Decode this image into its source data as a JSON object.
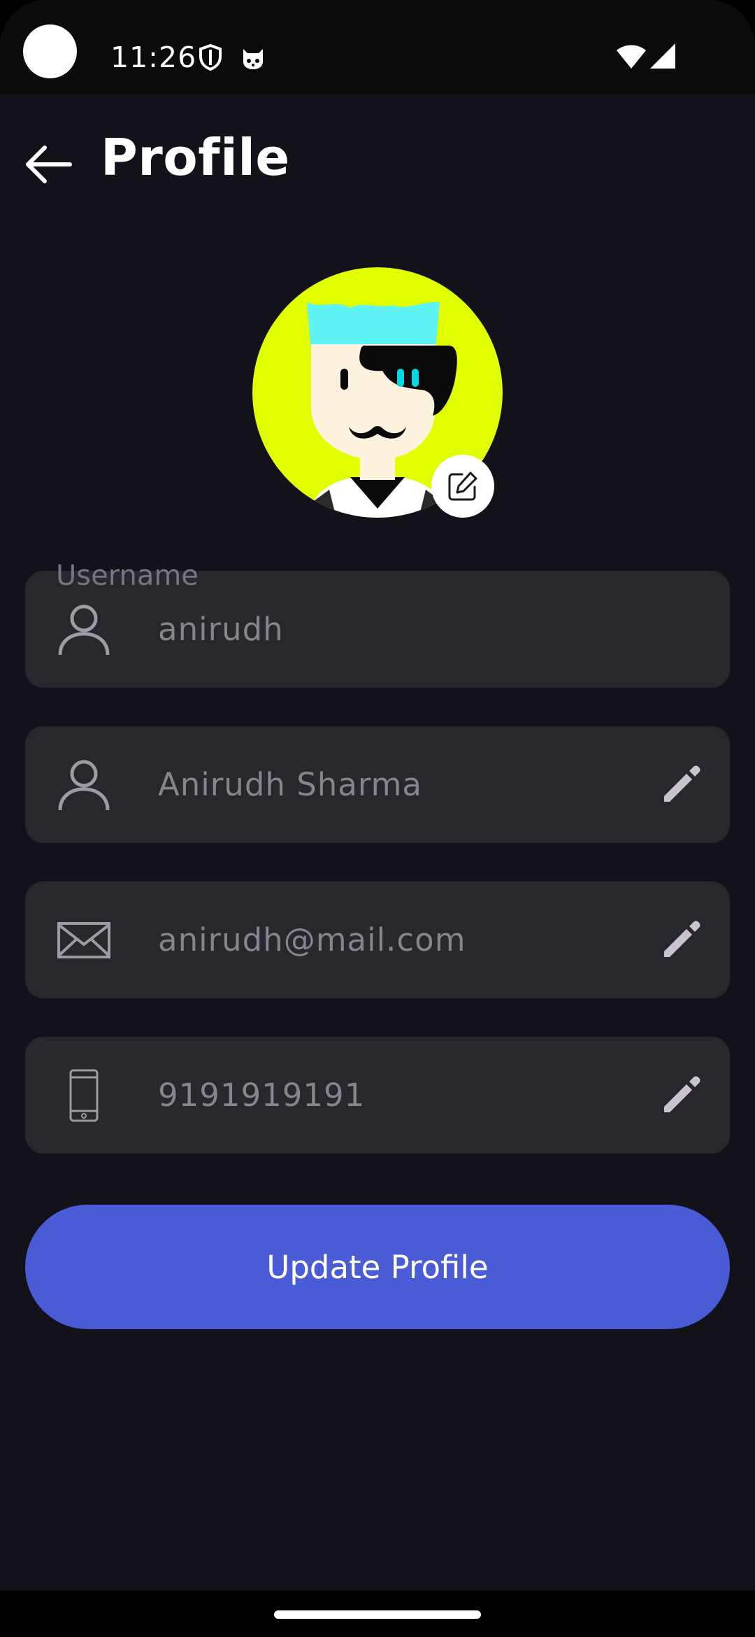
{
  "status_bar": {
    "time": "11:26",
    "icons": [
      "shield-icon",
      "cat-face-icon",
      "wifi-icon",
      "cellular-signal-icon"
    ]
  },
  "header": {
    "title": "Profile",
    "back_icon": "arrow-left-icon"
  },
  "avatar": {
    "edit_icon": "edit-square-icon",
    "colors": {
      "background": "#e2ff00",
      "hair": "#5ef4f6",
      "skin": "#fdf2dd",
      "mask": "#0a0a0a",
      "eyes": "#00d8e6"
    }
  },
  "form": {
    "username": {
      "label": "Username",
      "value": "anirudh",
      "icon": "person-icon",
      "editable": false
    },
    "full_name": {
      "value": "Anirudh Sharma",
      "icon": "person-icon",
      "edit_icon": "pencil-icon"
    },
    "email": {
      "value": "anirudh@mail.com",
      "icon": "envelope-icon",
      "edit_icon": "pencil-icon"
    },
    "phone": {
      "value": "9191919191",
      "icon": "mobile-phone-icon",
      "edit_icon": "pencil-icon"
    }
  },
  "actions": {
    "update_label": "Update Profile"
  },
  "colors": {
    "background": "#13121a",
    "field_background": "#28272e",
    "field_text": "#86848c",
    "accent": "#4a5bd6",
    "pencil": "#cac4d0"
  }
}
